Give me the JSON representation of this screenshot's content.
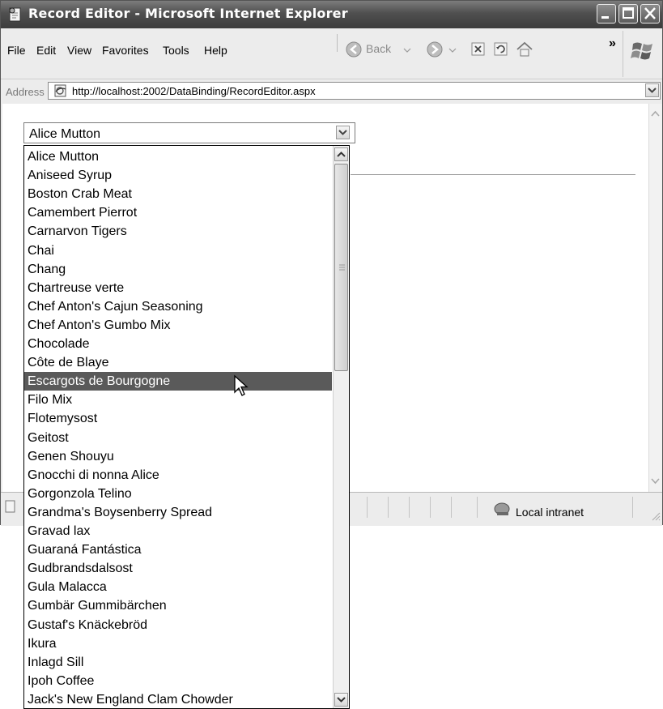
{
  "window": {
    "title": "Record Editor - Microsoft Internet Explorer"
  },
  "menu": {
    "items": [
      "File",
      "Edit",
      "View",
      "Favorites",
      "Tools",
      "Help"
    ]
  },
  "toolbar": {
    "back_label": "Back",
    "overflow": "»"
  },
  "address": {
    "label": "Address",
    "url": "http://localhost:2002/DataBinding/RecordEditor.aspx"
  },
  "status": {
    "zone": "Local intranet"
  },
  "dropdown": {
    "selected_value": "Alice Mutton",
    "highlighted_index": 12,
    "options": [
      "Alice Mutton",
      "Aniseed Syrup",
      "Boston Crab Meat",
      "Camembert Pierrot",
      "Carnarvon Tigers",
      "Chai",
      "Chang",
      "Chartreuse verte",
      "Chef Anton's Cajun Seasoning",
      "Chef Anton's Gumbo Mix",
      "Chocolade",
      "Côte de Blaye",
      "Escargots de Bourgogne",
      "Filo Mix",
      "Flotemysost",
      "Geitost",
      "Genen Shouyu",
      "Gnocchi di nonna Alice",
      "Gorgonzola Telino",
      "Grandma's Boysenberry Spread",
      "Gravad lax",
      "Guaraná Fantástica",
      "Gudbrandsdalsost",
      "Gula Malacca",
      "Gumbär Gummibärchen",
      "Gustaf's Knäckebröd",
      "Ikura",
      "Inlagd Sill",
      "Ipoh Coffee",
      "Jack's New England Clam Chowder"
    ]
  },
  "icons": {
    "ie": "ie-page-icon",
    "minimize": "minimize-icon",
    "maximize": "maximize-icon",
    "close": "close-icon",
    "back": "back-arrow-icon",
    "forward": "forward-arrow-icon",
    "stop": "stop-icon",
    "refresh": "refresh-icon",
    "home": "home-icon",
    "windows_logo": "windows-logo-icon",
    "intranet": "local-intranet-icon"
  }
}
